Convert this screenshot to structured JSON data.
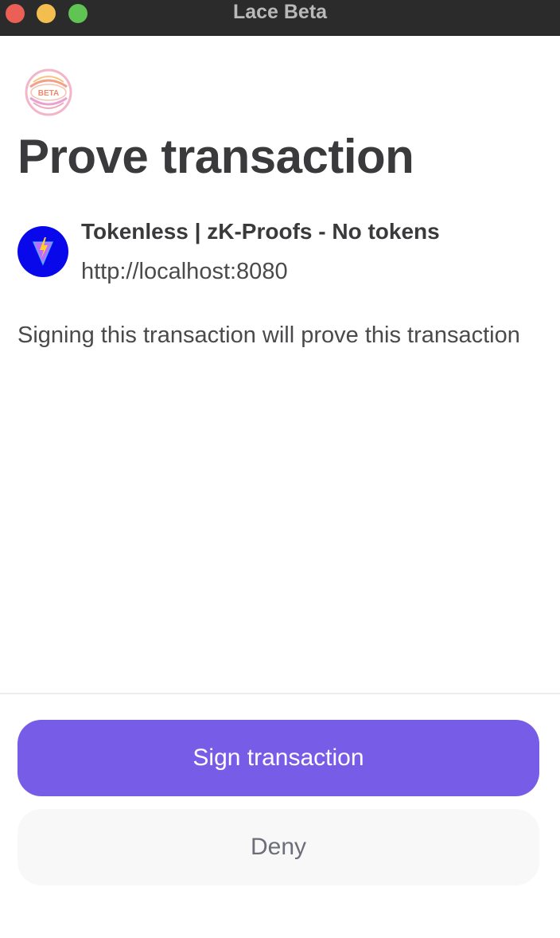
{
  "window": {
    "title": "Lace Beta"
  },
  "logo": {
    "badge_text": "BETA"
  },
  "page": {
    "title": "Prove transaction"
  },
  "dapp": {
    "name": "Tokenless | zK-Proofs - No tokens",
    "url": "http://localhost:8080",
    "icon": "vite-logo-icon"
  },
  "description": "Signing this transaction will prove this transaction",
  "actions": {
    "sign_label": "Sign transaction",
    "deny_label": "Deny"
  },
  "colors": {
    "primary": "#775ce8",
    "titlebar": "#2b2b2b",
    "dapp_icon_bg": "#0808ea",
    "text_dark": "#3a3a3c"
  }
}
